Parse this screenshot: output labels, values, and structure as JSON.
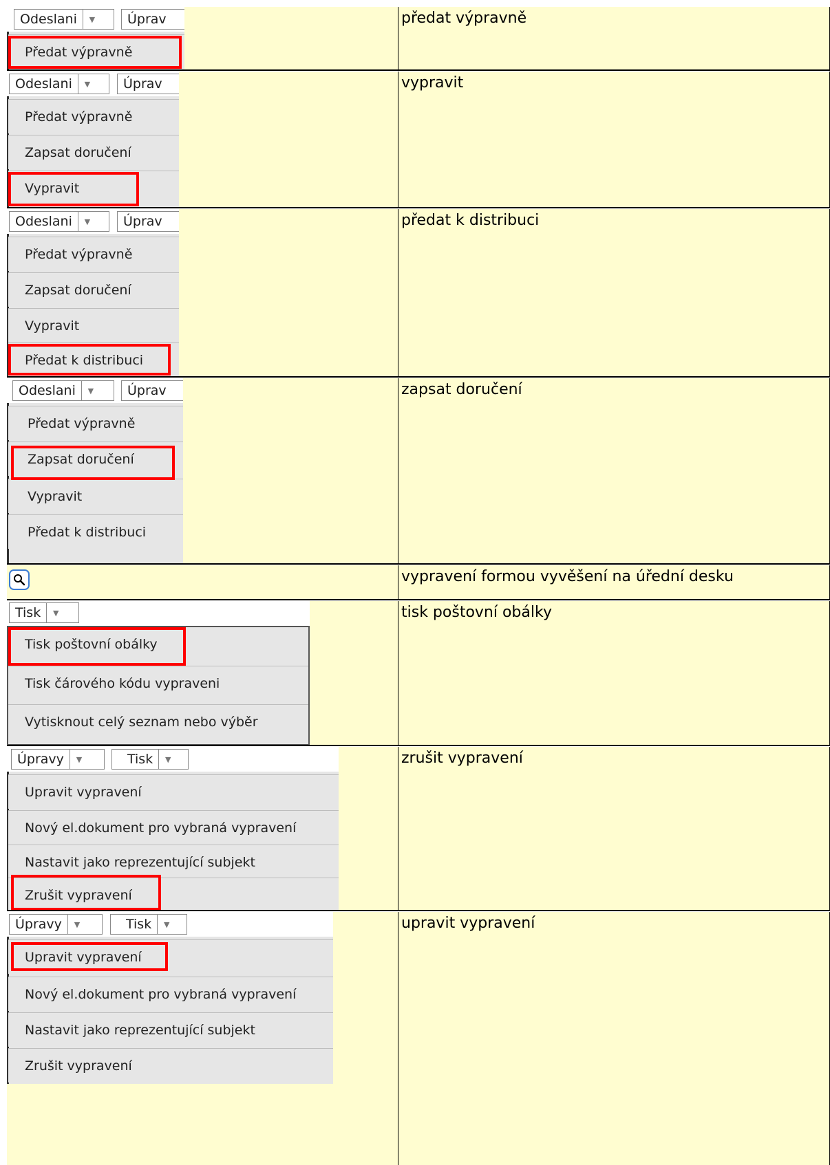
{
  "rows": [
    {
      "description": "předat výpravně",
      "toolbar": [
        "Odeslani",
        "Úprav"
      ],
      "menu": [
        "Předat výpravně"
      ],
      "highlight": "Předat výpravně"
    },
    {
      "description": "vypravit",
      "toolbar": [
        "Odeslani",
        "Úprav"
      ],
      "menu": [
        "Předat výpravně",
        "Zapsat doručení",
        "Vypravit"
      ],
      "highlight": "Vypravit"
    },
    {
      "description": "předat k distribuci",
      "toolbar": [
        "Odeslani",
        "Úprav"
      ],
      "menu": [
        "Předat výpravně",
        "Zapsat doručení",
        "Vypravit",
        "Předat k distribuci"
      ],
      "highlight": "Předat k distribuci"
    },
    {
      "description": "zapsat doručení",
      "toolbar": [
        "Odeslani",
        "Úprav"
      ],
      "menu": [
        "Předat výpravně",
        "Zapsat doručení",
        "Vypravit",
        "Předat k distribuci"
      ],
      "highlight": "Zapsat doručení"
    },
    {
      "description": "vypravení formou vyvěšení na úřední desku",
      "icon": "search-icon"
    },
    {
      "description": "tisk poštovní obálky",
      "toolbar": [
        "Tisk"
      ],
      "menu": [
        "Tisk poštovní obálky",
        "Tisk čárového kódu vypraveni",
        "Vytisknout celý seznam nebo výběr"
      ],
      "highlight": "Tisk poštovní obálky"
    },
    {
      "description": "zrušit vypravení",
      "toolbar": [
        "Úpravy",
        "Tisk"
      ],
      "menu": [
        "Upravit vypravení",
        "Nový el.dokument pro vybraná vypravení",
        "Nastavit jako reprezentující subjekt",
        "Zrušit vypravení"
      ],
      "highlight": "Zrušit vypravení"
    },
    {
      "description": "upravit vypravení",
      "toolbar": [
        "Úpravy",
        "Tisk"
      ],
      "menu": [
        "Upravit vypravení",
        "Nový el.dokument pro vybraná vypravení",
        "Nastavit jako reprezentující subjekt",
        "Zrušit vypravení"
      ],
      "highlight": "Upravit vypravení"
    }
  ],
  "colors": {
    "cell_background": "#fffdd0",
    "highlight": "#ff0000",
    "menu_background": "#e6e6e6",
    "icon_border": "#3a7bd5"
  }
}
